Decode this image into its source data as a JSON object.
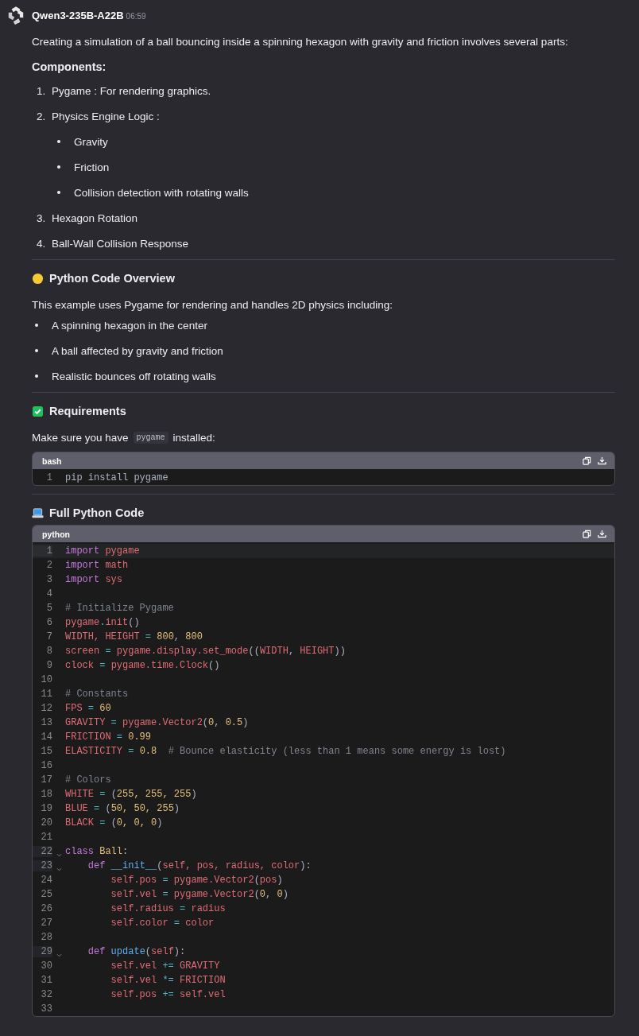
{
  "message": {
    "model": "Qwen3-235B-A22B",
    "time": "06:59"
  },
  "intro": "Creating a simulation of a ball bouncing inside a spinning hexagon with gravity and friction involves several parts:",
  "components": {
    "heading": "Components:",
    "items": [
      {
        "number": "1.",
        "text": "Pygame : For rendering graphics."
      },
      {
        "number": "2.",
        "text": "Physics Engine Logic :",
        "children": [
          {
            "text": "Gravity"
          },
          {
            "text": "Friction"
          },
          {
            "text": "Collision detection with rotating walls"
          }
        ]
      },
      {
        "number": "3.",
        "text": "Hexagon Rotation"
      },
      {
        "number": "4.",
        "text": "Ball-Wall Collision Response"
      }
    ]
  },
  "overview": {
    "heading": "Python Code Overview",
    "text": "This example uses Pygame for rendering and handles 2D physics including:",
    "bullets": [
      "A spinning hexagon in the center",
      "A ball affected by gravity and friction",
      "Realistic bounces off rotating walls"
    ]
  },
  "requirements": {
    "heading": "Requirements",
    "before": "Make sure you have",
    "code": "pygame",
    "after": "installed:"
  },
  "bash_block": {
    "language": "bash",
    "lines": [
      {
        "n": "1",
        "fold": false,
        "active": false,
        "tokens": [
          {
            "text": "pip install pygame",
            "kind": "plain"
          }
        ]
      }
    ]
  },
  "full_code": {
    "heading": "Full Python Code"
  },
  "python_block": {
    "language": "python",
    "lines": [
      {
        "n": "1",
        "fold": false,
        "active": true,
        "tokens": [
          {
            "text": "import",
            "kind": "kw"
          },
          {
            "text": " pygame",
            "kind": "var"
          }
        ]
      },
      {
        "n": "2",
        "fold": false,
        "active": false,
        "tokens": [
          {
            "text": "import",
            "kind": "kw"
          },
          {
            "text": " math",
            "kind": "var"
          }
        ]
      },
      {
        "n": "3",
        "fold": false,
        "active": false,
        "tokens": [
          {
            "text": "import",
            "kind": "kw"
          },
          {
            "text": " sys",
            "kind": "var"
          }
        ]
      },
      {
        "n": "4",
        "fold": false,
        "active": false
      },
      {
        "n": "5",
        "fold": false,
        "active": false,
        "tokens": [
          {
            "text": "# Initialize Pygame",
            "kind": "comment"
          }
        ]
      },
      {
        "n": "6",
        "fold": false,
        "active": false,
        "tokens": [
          {
            "text": "pygame",
            "kind": "var"
          },
          {
            "text": ".",
            "kind": "op"
          },
          {
            "text": "init",
            "kind": "var"
          },
          {
            "text": "()",
            "kind": "plain"
          }
        ]
      },
      {
        "n": "7",
        "fold": false,
        "active": false,
        "tokens": [
          {
            "text": "WIDTH, HEIGHT",
            "kind": "var"
          },
          {
            "text": " = ",
            "kind": "op"
          },
          {
            "text": "800",
            "kind": "num"
          },
          {
            "text": ", ",
            "kind": "plain"
          },
          {
            "text": "800",
            "kind": "num"
          }
        ]
      },
      {
        "n": "8",
        "fold": false,
        "active": false,
        "tokens": [
          {
            "text": "screen",
            "kind": "var"
          },
          {
            "text": " = ",
            "kind": "op"
          },
          {
            "text": "pygame.display.set_mode",
            "kind": "var"
          },
          {
            "text": "((",
            "kind": "plain"
          },
          {
            "text": "WIDTH",
            "kind": "var"
          },
          {
            "text": ", ",
            "kind": "plain"
          },
          {
            "text": "HEIGHT",
            "kind": "var"
          },
          {
            "text": "))",
            "kind": "plain"
          }
        ]
      },
      {
        "n": "9",
        "fold": false,
        "active": false,
        "tokens": [
          {
            "text": "clock",
            "kind": "var"
          },
          {
            "text": " = ",
            "kind": "op"
          },
          {
            "text": "pygame.time.Clock",
            "kind": "var"
          },
          {
            "text": "()",
            "kind": "plain"
          }
        ]
      },
      {
        "n": "10",
        "fold": false,
        "active": false
      },
      {
        "n": "11",
        "fold": false,
        "active": false,
        "tokens": [
          {
            "text": "# Constants",
            "kind": "comment"
          }
        ]
      },
      {
        "n": "12",
        "fold": false,
        "active": false,
        "tokens": [
          {
            "text": "FPS",
            "kind": "var"
          },
          {
            "text": " = ",
            "kind": "op"
          },
          {
            "text": "60",
            "kind": "num"
          }
        ]
      },
      {
        "n": "13",
        "fold": false,
        "active": false,
        "tokens": [
          {
            "text": "GRAVITY",
            "kind": "var"
          },
          {
            "text": " = ",
            "kind": "op"
          },
          {
            "text": "pygame.Vector2",
            "kind": "var"
          },
          {
            "text": "(",
            "kind": "plain"
          },
          {
            "text": "0",
            "kind": "num"
          },
          {
            "text": ", ",
            "kind": "plain"
          },
          {
            "text": "0.5",
            "kind": "num"
          },
          {
            "text": ")",
            "kind": "plain"
          }
        ]
      },
      {
        "n": "14",
        "fold": false,
        "active": false,
        "tokens": [
          {
            "text": "FRICTION",
            "kind": "var"
          },
          {
            "text": " = ",
            "kind": "op"
          },
          {
            "text": "0.99",
            "kind": "num"
          }
        ]
      },
      {
        "n": "15",
        "fold": false,
        "active": false,
        "tokens": [
          {
            "text": "ELASTICITY",
            "kind": "var"
          },
          {
            "text": " = ",
            "kind": "op"
          },
          {
            "text": "0.8",
            "kind": "num"
          },
          {
            "text": "  # Bounce elasticity (less than 1 means some energy is lost)",
            "kind": "comment"
          }
        ]
      },
      {
        "n": "16",
        "fold": false,
        "active": false
      },
      {
        "n": "17",
        "fold": false,
        "active": false,
        "tokens": [
          {
            "text": "# Colors",
            "kind": "comment"
          }
        ]
      },
      {
        "n": "18",
        "fold": false,
        "active": false,
        "tokens": [
          {
            "text": "WHITE",
            "kind": "var"
          },
          {
            "text": " = ",
            "kind": "op"
          },
          {
            "text": "(",
            "kind": "plain"
          },
          {
            "text": "255, 255, 255",
            "kind": "num"
          },
          {
            "text": ")",
            "kind": "plain"
          }
        ]
      },
      {
        "n": "19",
        "fold": false,
        "active": false,
        "tokens": [
          {
            "text": "BLUE",
            "kind": "var"
          },
          {
            "text": " = ",
            "kind": "op"
          },
          {
            "text": "(",
            "kind": "plain"
          },
          {
            "text": "50, 50, 255",
            "kind": "num"
          },
          {
            "text": ")",
            "kind": "plain"
          }
        ]
      },
      {
        "n": "20",
        "fold": false,
        "active": false,
        "tokens": [
          {
            "text": "BLACK",
            "kind": "var"
          },
          {
            "text": " = ",
            "kind": "op"
          },
          {
            "text": "(",
            "kind": "plain"
          },
          {
            "text": "0, 0, 0",
            "kind": "num"
          },
          {
            "text": ")",
            "kind": "plain"
          }
        ]
      },
      {
        "n": "21",
        "fold": false,
        "active": false
      },
      {
        "n": "22",
        "fold": true,
        "active": false,
        "tokens": [
          {
            "text": "class",
            "kind": "kw"
          },
          {
            "text": " Ball",
            "kind": "cls"
          },
          {
            "text": ":",
            "kind": "plain"
          }
        ]
      },
      {
        "n": "23",
        "fold": true,
        "active": false,
        "tokens": [
          {
            "text": "    def",
            "kind": "kw"
          },
          {
            "text": " __init__",
            "kind": "fn"
          },
          {
            "text": "(",
            "kind": "plain"
          },
          {
            "text": "self, pos, radius, color",
            "kind": "var"
          },
          {
            "text": "):",
            "kind": "plain"
          }
        ]
      },
      {
        "n": "24",
        "fold": false,
        "active": false,
        "tokens": [
          {
            "text": "        self.pos",
            "kind": "var"
          },
          {
            "text": " = ",
            "kind": "op"
          },
          {
            "text": "pygame.Vector2",
            "kind": "var"
          },
          {
            "text": "(",
            "kind": "plain"
          },
          {
            "text": "pos",
            "kind": "var"
          },
          {
            "text": ")",
            "kind": "plain"
          }
        ]
      },
      {
        "n": "25",
        "fold": false,
        "active": false,
        "tokens": [
          {
            "text": "        self.vel",
            "kind": "var"
          },
          {
            "text": " = ",
            "kind": "op"
          },
          {
            "text": "pygame.Vector2",
            "kind": "var"
          },
          {
            "text": "(",
            "kind": "plain"
          },
          {
            "text": "0",
            "kind": "num"
          },
          {
            "text": ", ",
            "kind": "plain"
          },
          {
            "text": "0",
            "kind": "num"
          },
          {
            "text": ")",
            "kind": "plain"
          }
        ]
      },
      {
        "n": "26",
        "fold": false,
        "active": false,
        "tokens": [
          {
            "text": "        self.radius",
            "kind": "var"
          },
          {
            "text": " = ",
            "kind": "op"
          },
          {
            "text": "radius",
            "kind": "var"
          }
        ]
      },
      {
        "n": "27",
        "fold": false,
        "active": false,
        "tokens": [
          {
            "text": "        self.color",
            "kind": "var"
          },
          {
            "text": " = ",
            "kind": "op"
          },
          {
            "text": "color",
            "kind": "var"
          }
        ]
      },
      {
        "n": "28",
        "fold": false,
        "active": false
      },
      {
        "n": "29",
        "fold": true,
        "active": false,
        "tokens": [
          {
            "text": "    def",
            "kind": "kw"
          },
          {
            "text": " update",
            "kind": "fn"
          },
          {
            "text": "(",
            "kind": "plain"
          },
          {
            "text": "self",
            "kind": "var"
          },
          {
            "text": "):",
            "kind": "plain"
          }
        ]
      },
      {
        "n": "30",
        "fold": false,
        "active": false,
        "tokens": [
          {
            "text": "        self.vel",
            "kind": "var"
          },
          {
            "text": " += ",
            "kind": "op"
          },
          {
            "text": "GRAVITY",
            "kind": "var"
          }
        ]
      },
      {
        "n": "31",
        "fold": false,
        "active": false,
        "tokens": [
          {
            "text": "        self.vel",
            "kind": "var"
          },
          {
            "text": " *= ",
            "kind": "op"
          },
          {
            "text": "FRICTION",
            "kind": "var"
          }
        ]
      },
      {
        "n": "32",
        "fold": false,
        "active": false,
        "tokens": [
          {
            "text": "        self.pos",
            "kind": "var"
          },
          {
            "text": " += ",
            "kind": "op"
          },
          {
            "text": "self.vel",
            "kind": "var"
          }
        ]
      },
      {
        "n": "33",
        "fold": false,
        "active": false
      }
    ]
  }
}
